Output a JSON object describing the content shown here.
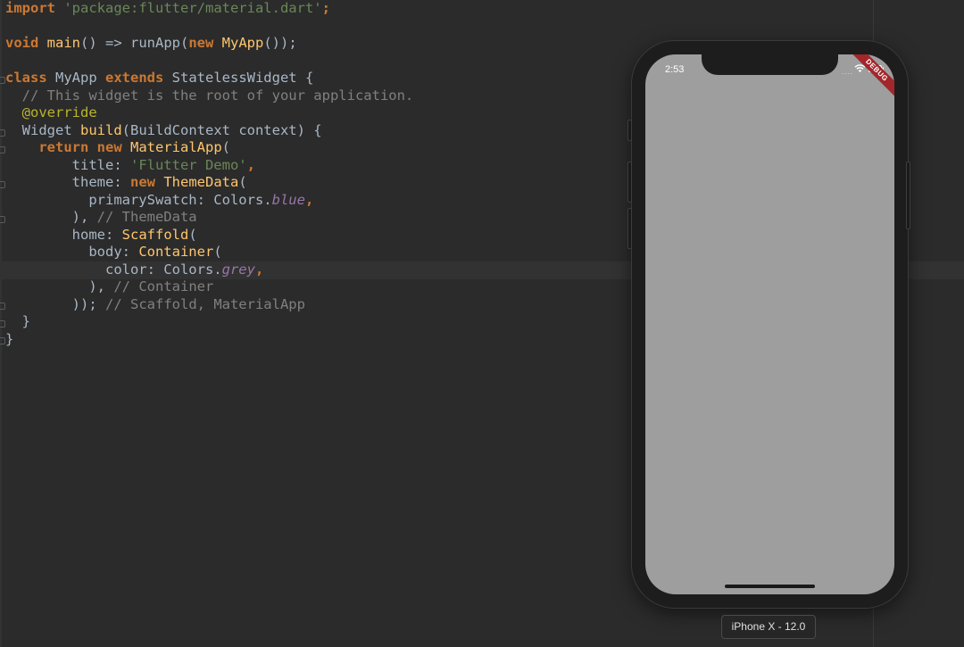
{
  "editor": {
    "lines": [
      [
        {
          "t": "import",
          "c": "kw"
        },
        {
          "t": " "
        },
        {
          "t": "'package:flutter/material.dart'",
          "c": "str"
        },
        {
          "t": ";",
          "c": "kw"
        }
      ],
      [],
      [
        {
          "t": "void",
          "c": "kw"
        },
        {
          "t": " "
        },
        {
          "t": "main",
          "c": "fn"
        },
        {
          "t": "() => runApp("
        },
        {
          "t": "new",
          "c": "kw"
        },
        {
          "t": " "
        },
        {
          "t": "MyApp",
          "c": "fn"
        },
        {
          "t": "());"
        }
      ],
      [],
      [
        {
          "t": "class",
          "c": "kw"
        },
        {
          "t": " MyApp "
        },
        {
          "t": "extends",
          "c": "kw"
        },
        {
          "t": " StatelessWidget {"
        }
      ],
      [
        {
          "t": "  "
        },
        {
          "t": "// This widget is the root of your application.",
          "c": "cm"
        }
      ],
      [
        {
          "t": "  "
        },
        {
          "t": "@override",
          "c": "ann"
        }
      ],
      [
        {
          "t": "  Widget "
        },
        {
          "t": "build",
          "c": "fn"
        },
        {
          "t": "(BuildContext context) {"
        }
      ],
      [
        {
          "t": "    "
        },
        {
          "t": "return new",
          "c": "kw"
        },
        {
          "t": " "
        },
        {
          "t": "MaterialApp",
          "c": "fn"
        },
        {
          "t": "("
        }
      ],
      [
        {
          "t": "        title: "
        },
        {
          "t": "'Flutter Demo'",
          "c": "str"
        },
        {
          "t": ",",
          "c": "kw"
        }
      ],
      [
        {
          "t": "        theme: "
        },
        {
          "t": "new",
          "c": "kw"
        },
        {
          "t": " "
        },
        {
          "t": "ThemeData",
          "c": "fn"
        },
        {
          "t": "("
        }
      ],
      [
        {
          "t": "          primarySwatch: Colors."
        },
        {
          "t": "blue",
          "c": "it"
        },
        {
          "t": ",",
          "c": "kw"
        }
      ],
      [
        {
          "t": "        ), "
        },
        {
          "t": "// ThemeData",
          "c": "cm"
        }
      ],
      [
        {
          "t": "        home: "
        },
        {
          "t": "Scaffold",
          "c": "fn"
        },
        {
          "t": "("
        }
      ],
      [
        {
          "t": "          body: "
        },
        {
          "t": "Container",
          "c": "fn"
        },
        {
          "t": "("
        }
      ],
      [
        {
          "t": "            color: Colors."
        },
        {
          "t": "grey",
          "c": "it"
        },
        {
          "t": ",",
          "c": "kw"
        }
      ],
      [
        {
          "t": "          ), "
        },
        {
          "t": "// Container",
          "c": "cm"
        }
      ],
      [
        {
          "t": "        ));"
        },
        {
          "t": " "
        },
        {
          "t": "// Scaffold, MaterialApp",
          "c": "cm"
        }
      ],
      [
        {
          "t": "  }"
        }
      ],
      [
        {
          "t": "}"
        }
      ]
    ]
  },
  "simulator": {
    "status_time": "2:53",
    "signal_dots": "....",
    "debug_banner": "DEBUG",
    "screen_color": "#9e9e9e",
    "device_label": "iPhone X - 12.0"
  },
  "colors": {
    "background": "#2b2b2b",
    "keyword": "#cc7832",
    "string": "#6a8759",
    "comment": "#808080",
    "annotation": "#bbb529",
    "function": "#ffc66d",
    "constant": "#9876aa",
    "text": "#a9b7c6"
  }
}
